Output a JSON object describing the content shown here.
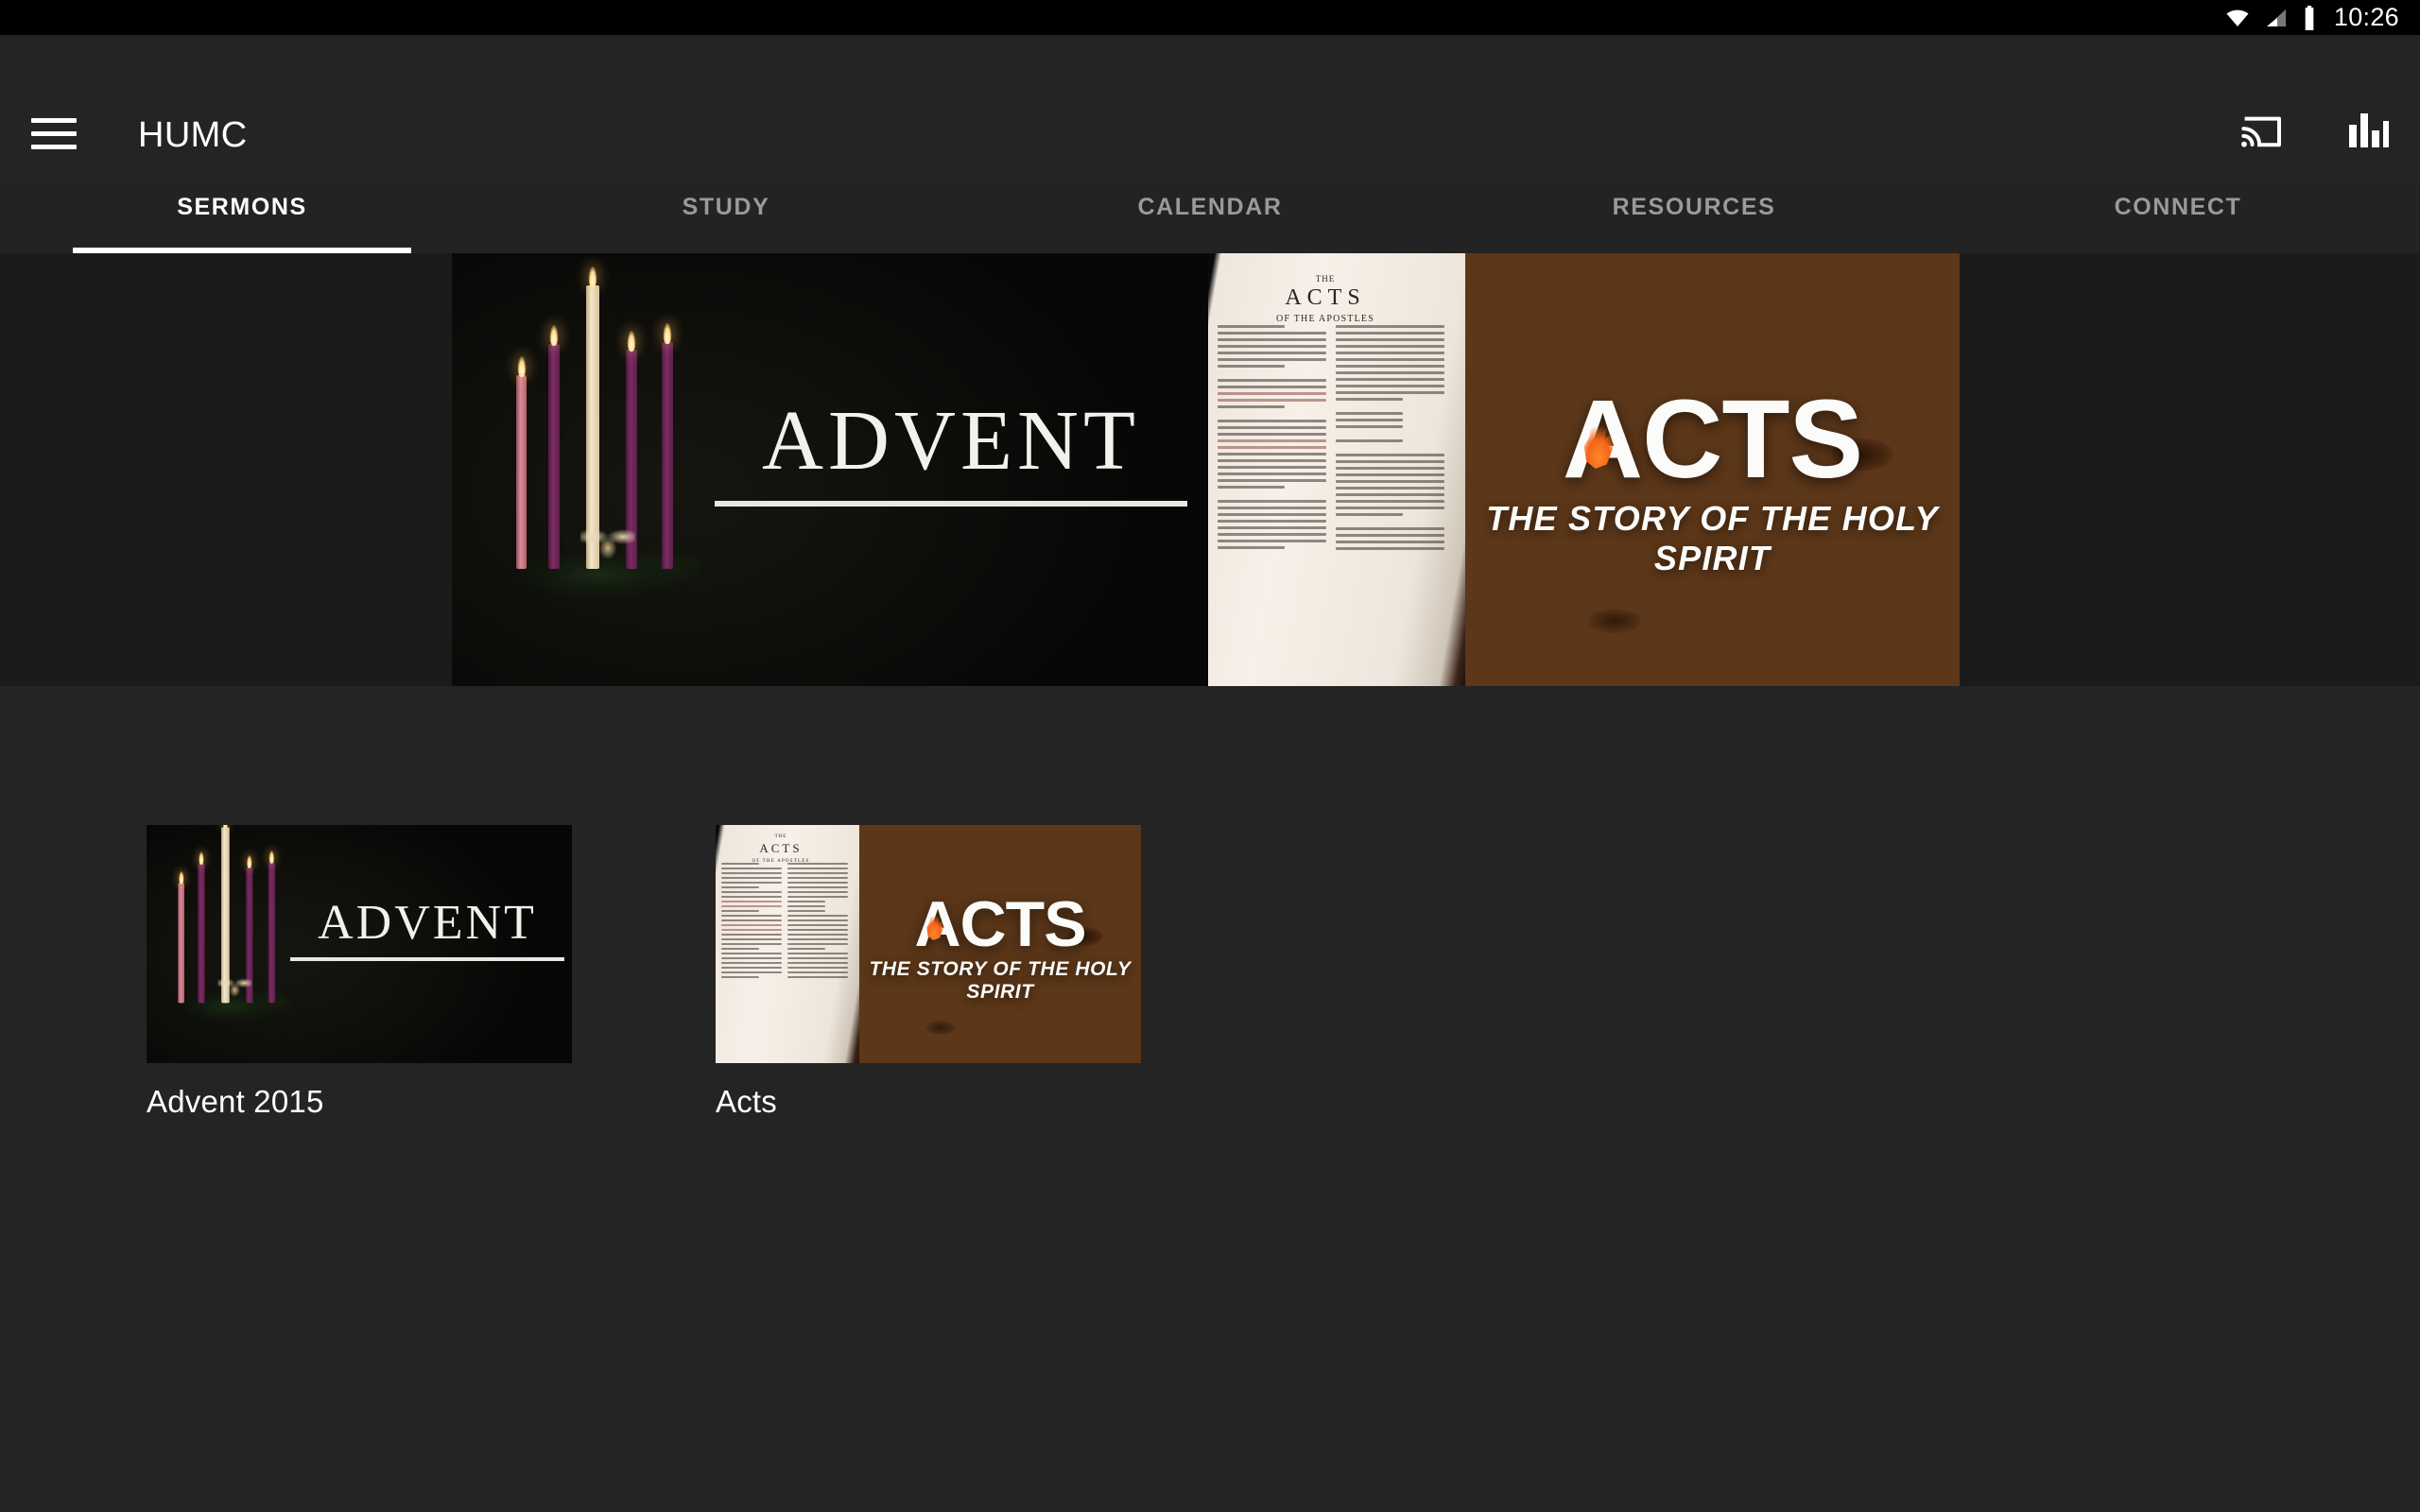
{
  "status_bar": {
    "time": "10:26",
    "icons": [
      "wifi-icon",
      "cell-signal-icon",
      "battery-icon"
    ]
  },
  "app_bar": {
    "menu_icon": "hamburger-menu-icon",
    "title": "HUMC",
    "actions": [
      {
        "name": "cast-icon",
        "label": "Cast"
      },
      {
        "name": "equalizer-icon",
        "label": "Now Playing"
      }
    ]
  },
  "tabs": {
    "active_index": 0,
    "items": [
      {
        "label": "SERMONS"
      },
      {
        "label": "STUDY"
      },
      {
        "label": "CALENDAR"
      },
      {
        "label": "RESOURCES"
      },
      {
        "label": "CONNECT"
      }
    ]
  },
  "hero": {
    "banners": [
      {
        "name": "advent-banner",
        "title": "ADVENT",
        "art": "advent-wreath-candles"
      },
      {
        "name": "acts-banner",
        "title": "ACTS",
        "subtitle": "THE STORY OF THE HOLY SPIRIT",
        "bible_heading_small": "THE",
        "bible_heading_main": "ACTS",
        "bible_heading_sub": "OF THE APOSTLES",
        "art": "open-bible-on-wood"
      }
    ]
  },
  "series": {
    "items": [
      {
        "label": "Advent 2015",
        "thumb_title": "ADVENT",
        "thumb_name": "advent-2015-thumbnail"
      },
      {
        "label": "Acts",
        "thumb_title": "ACTS",
        "thumb_subtitle": "THE STORY OF THE HOLY SPIRIT",
        "bible_heading_small": "THE",
        "bible_heading_main": "ACTS",
        "bible_heading_sub": "OF THE APOSTLES",
        "thumb_name": "acts-thumbnail"
      }
    ]
  },
  "colors": {
    "app_bar_bg": "#242424",
    "status_bar_bg": "#000000",
    "content_bg": "#242424",
    "accent_underline": "#ffffff",
    "tab_inactive": "#9a9a9a",
    "flame_orange": "#f4641a",
    "wood_brown": "#5c3719"
  }
}
